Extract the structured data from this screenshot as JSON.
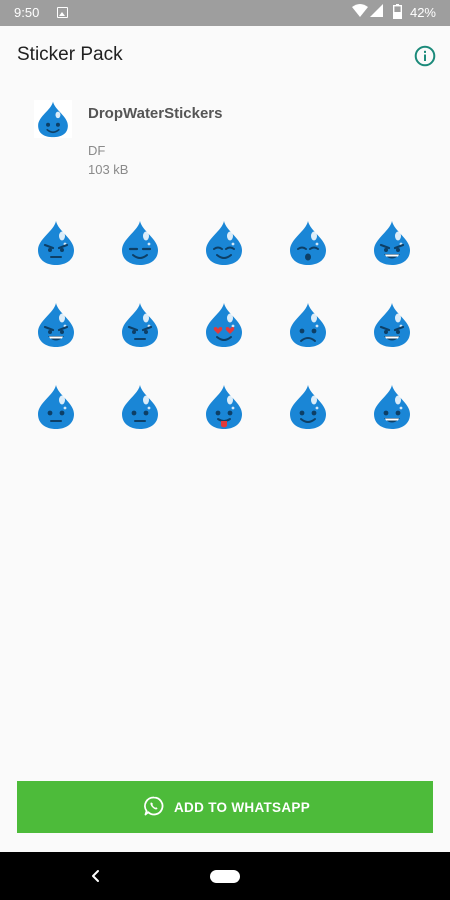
{
  "status_bar": {
    "time": "9:50",
    "battery": "42%",
    "icons": [
      "image-notification-icon",
      "wifi-icon",
      "signal-icon",
      "battery-icon"
    ]
  },
  "app_bar": {
    "title": "Sticker Pack",
    "info_icon": "info-icon",
    "accent_color": "#1b8a7a"
  },
  "pack": {
    "name": "DropWaterStickers",
    "publisher": "DF",
    "size": "103 kB",
    "tray_icon": "water-drop-icon"
  },
  "stickers": [
    {
      "name": "sticker-angry-drop",
      "expression": "angry"
    },
    {
      "name": "sticker-smirk-drop",
      "expression": "smirk"
    },
    {
      "name": "sticker-content-drop",
      "expression": "content"
    },
    {
      "name": "sticker-surprised-drop",
      "expression": "surprised"
    },
    {
      "name": "sticker-grin-drop",
      "expression": "grin"
    },
    {
      "name": "sticker-laugh-drop",
      "expression": "laugh"
    },
    {
      "name": "sticker-annoyed-drop",
      "expression": "annoyed"
    },
    {
      "name": "sticker-heart-eyes-drop",
      "expression": "heart-eyes"
    },
    {
      "name": "sticker-sad-drop",
      "expression": "sad"
    },
    {
      "name": "sticker-wink-grin-drop",
      "expression": "wink-grin"
    },
    {
      "name": "sticker-thinking-drop",
      "expression": "thinking"
    },
    {
      "name": "sticker-neutral-drop",
      "expression": "neutral"
    },
    {
      "name": "sticker-tongue-drop",
      "expression": "tongue"
    },
    {
      "name": "sticker-smile-drop",
      "expression": "smile"
    },
    {
      "name": "sticker-big-smile-drop",
      "expression": "big-smile"
    }
  ],
  "drop_color": "#1a86d6",
  "add_button": {
    "label": "ADD TO WHATSAPP",
    "icon": "whatsapp-icon",
    "color": "#4dbb3a"
  },
  "nav_bar": {
    "back_icon": "back-icon",
    "home_icon": "home-pill-icon"
  }
}
